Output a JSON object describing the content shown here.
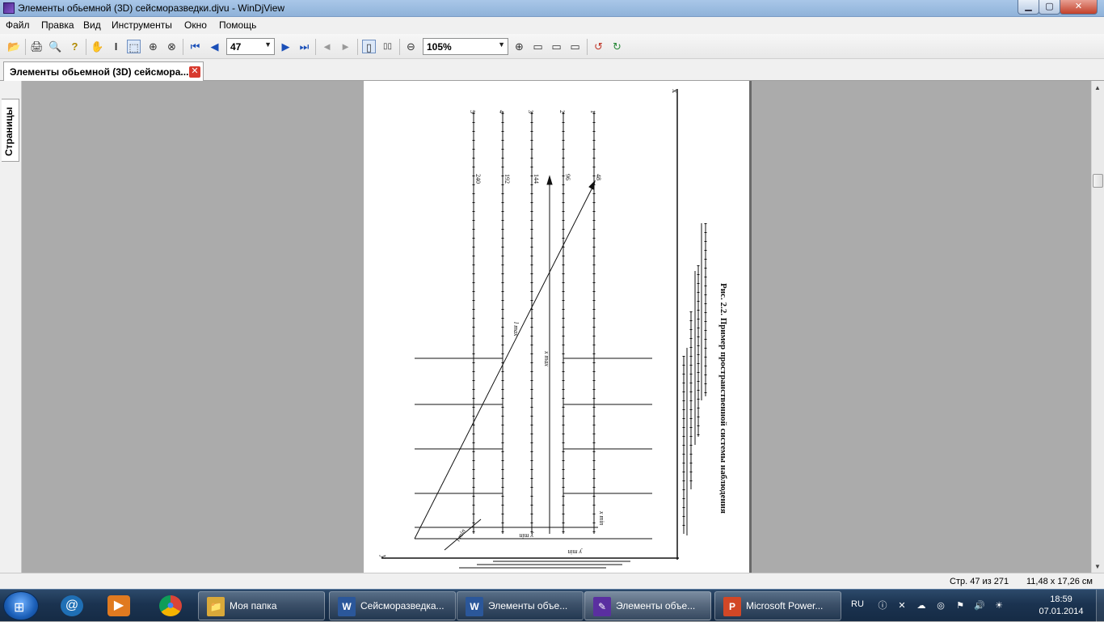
{
  "window": {
    "title": "Элементы обьемной (3D) сейсморазведки.djvu - WinDjView",
    "min_glyph": "▁",
    "max_glyph": "▢",
    "close_glyph": "✕"
  },
  "menu": {
    "items": [
      "Файл",
      "Правка",
      "Вид",
      "Инструменты",
      "Окно",
      "Помощь"
    ]
  },
  "toolbar": {
    "page_number": "47",
    "zoom": "105%",
    "icons": {
      "open": "📂",
      "print": "🖨",
      "find": "🔍",
      "help": "?",
      "hand": "✋",
      "select_text": "I",
      "select_rect": "⬚",
      "zoom_in_tool": "⊕",
      "zoom_rect": "⊗",
      "first": "⏮",
      "prev": "◀",
      "next": "▶",
      "last": "⏭",
      "back": "◄",
      "forward": "►",
      "single_page": "▯",
      "two_page": "▯▯",
      "zoom_out": "⊖",
      "zoom_in": "⊕",
      "fit_page": "▭",
      "fit_width": "▭",
      "actual": "▭",
      "rotate_left": "↺",
      "rotate_right": "↻"
    }
  },
  "tabs": {
    "doc_tab_label": "Элементы обьемной (3D) сейсмора...",
    "close_glyph": "✕"
  },
  "sidebar": {
    "pages_tab": "Страницы"
  },
  "figure": {
    "caption": "Рис. 2.2. Пример пространственной системы наблюдения",
    "line_numbers": [
      "5",
      "4",
      "3",
      "2",
      "1"
    ],
    "station_labels": [
      "240",
      "192",
      "144",
      "96",
      "48"
    ],
    "axis_x": "x",
    "axis_y": "y",
    "label_lmax": "l max",
    "label_xmax": "x max",
    "label_xmin": "x min",
    "label_ymin1": "y min",
    "label_ymin2": "y min",
    "label_lmin": "l min"
  },
  "statusbar": {
    "page_info": "Стр. 47 из 271",
    "page_size": "11,48 x 17,26 см"
  },
  "taskbar": {
    "start_glyph": "⊞",
    "pinned": [
      {
        "name": "mail-agent",
        "glyph": "@",
        "color": "#1f6fb5"
      },
      {
        "name": "media-player",
        "glyph": "▶",
        "color": "#e07a20"
      },
      {
        "name": "chrome",
        "glyph": "●",
        "color": "#db4437"
      }
    ],
    "tasks": [
      {
        "label": "Моя папка",
        "icon": "📁",
        "icon_color": "#d9a93a"
      },
      {
        "label": "Сейсморазведка...",
        "icon": "W",
        "icon_color": "#2b579a"
      },
      {
        "label": "Элементы объе...",
        "icon": "W",
        "icon_color": "#2b579a"
      },
      {
        "label": "Элементы объе...",
        "icon": "✎",
        "icon_color": "#5a2fa0"
      },
      {
        "label": "Microsoft Power...",
        "icon": "P",
        "icon_color": "#d24726"
      }
    ],
    "tray": {
      "language": "RU",
      "icons": [
        "ⓘ",
        "✕",
        "☁",
        "◎",
        "⚑",
        "🔊",
        "☀"
      ]
    },
    "clock_time": "18:59",
    "clock_date": "07.01.2014"
  }
}
